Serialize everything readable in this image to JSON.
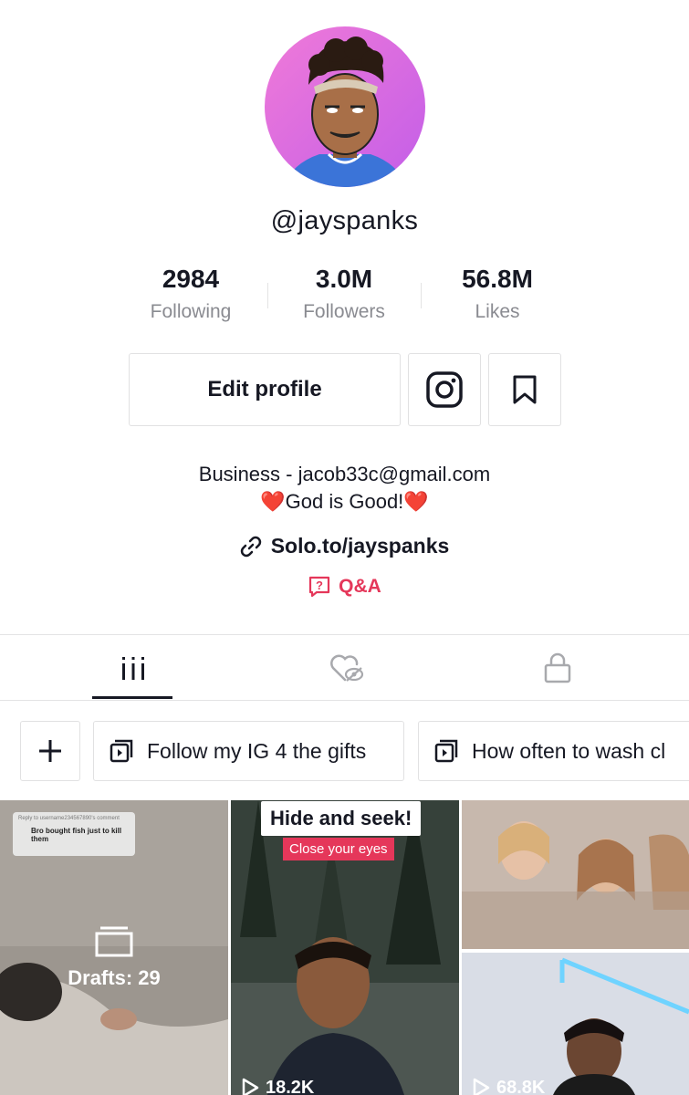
{
  "profile": {
    "username": "@jayspanks",
    "stats": [
      {
        "value": "2984",
        "label": "Following"
      },
      {
        "value": "3.0M",
        "label": "Followers"
      },
      {
        "value": "56.8M",
        "label": "Likes"
      }
    ],
    "edit_label": "Edit profile",
    "bio_line1": "Business - jacob33c@gmail.com",
    "bio_line2": "God is Good!",
    "bio_emoji": "❤️",
    "link": "Solo.to/jayspanks",
    "qa_label": "Q&A"
  },
  "tabs": [
    {
      "icon": "grid-icon",
      "active": true
    },
    {
      "icon": "liked-hidden-icon",
      "active": false
    },
    {
      "icon": "lock-icon",
      "active": false
    }
  ],
  "playlists": [
    {
      "label": "Follow my IG 4 the gifts"
    },
    {
      "label": "How often to wash cl"
    }
  ],
  "videos": [
    {
      "reply_header": "Reply to username234567890's comment",
      "reply_text": "Bro bought fish just to kill them",
      "drafts": "Drafts: 29"
    },
    {
      "overlay_title": "Hide and seek!",
      "overlay_sub": "Close your eyes",
      "views": "18.2K"
    },
    {
      "views": "68.8K"
    }
  ],
  "colors": {
    "accent": "#e5375a",
    "text": "#161823",
    "muted": "#8a8b91",
    "border": "#e1e1e2"
  }
}
